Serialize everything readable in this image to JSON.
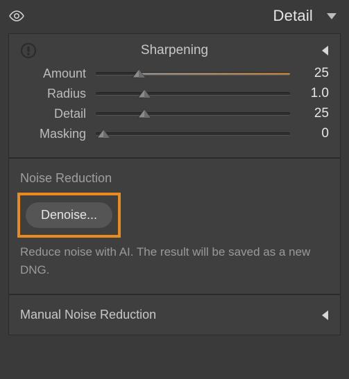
{
  "panel": {
    "title": "Detail"
  },
  "sharpening": {
    "title": "Sharpening",
    "sliders": {
      "amount": {
        "label": "Amount",
        "value": "25",
        "pos": 22
      },
      "radius": {
        "label": "Radius",
        "value": "1.0",
        "pos": 25
      },
      "detail": {
        "label": "Detail",
        "value": "25",
        "pos": 25
      },
      "masking": {
        "label": "Masking",
        "value": "0",
        "pos": 0
      }
    }
  },
  "noise": {
    "title": "Noise Reduction",
    "denoise_label": "Denoise...",
    "help": "Reduce noise with AI. The result will be saved as a new DNG."
  },
  "manual": {
    "title": "Manual Noise Reduction"
  }
}
